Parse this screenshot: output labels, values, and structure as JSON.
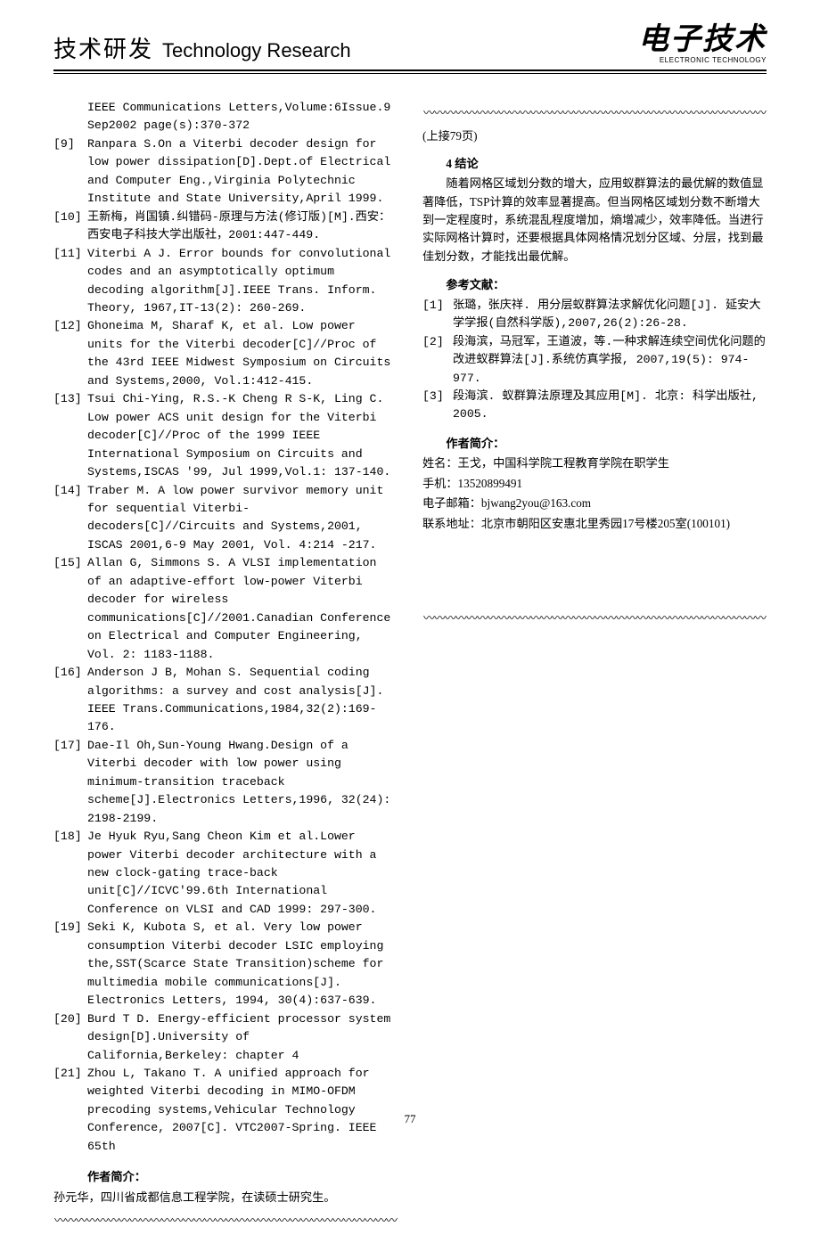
{
  "header": {
    "cn": "技术研发",
    "en": "Technology Research",
    "masthead_cn": "电子技术",
    "masthead_en": "ELECTRONIC TECHNOLOGY"
  },
  "left_col": {
    "cont8": "IEEE Communications Letters,Volume:6Issue.9 Sep2002 page(s):370-372",
    "refs": [
      {
        "n": "[9]",
        "t": "Ranpara S.On a Viterbi decoder design for low power dissipation[D].Dept.of Electrical and Computer Eng.,Virginia Polytechnic Institute and State University,April 1999."
      },
      {
        "n": "[10]",
        "t": "王新梅，肖国镇.纠错码-原理与方法(修订版)[M].西安：西安电子科技大学出版社，2001:447-449."
      },
      {
        "n": "[11]",
        "t": "Viterbi A J. Error bounds for convolutional codes and an asymptotically optimum decoding algorithm[J].IEEE Trans. Inform. Theory, 1967,IT-13(2): 260-269."
      },
      {
        "n": "[12]",
        "t": "Ghoneima M, Sharaf K, et al. Low power units for the Viterbi decoder[C]//Proc of the 43rd IEEE Midwest Symposium on Circuits and Systems,2000, Vol.1:412-415."
      },
      {
        "n": "[13]",
        "t": "Tsui Chi-Ying, R.S.-K Cheng R S-K, Ling C. Low power ACS unit design for the Viterbi decoder[C]//Proc of the 1999 IEEE International Symposium on Circuits and Systems,ISCAS '99, Jul 1999,Vol.1: 137-140."
      },
      {
        "n": "[14]",
        "t": "Traber M. A low power survivor memory unit for sequential Viterbi-decoders[C]//Circuits and Systems,2001, ISCAS 2001,6-9 May 2001, Vol. 4:214 -217."
      },
      {
        "n": "[15]",
        "t": "Allan G, Simmons S. A VLSI implementation of an adaptive-effort low-power Viterbi decoder for wireless communications[C]//2001.Canadian Conference on Electrical and Computer Engineering, Vol. 2: 1183-1188."
      },
      {
        "n": "[16]",
        "t": "Anderson J B, Mohan S. Sequential coding algorithms: a survey and cost analysis[J]. IEEE Trans.Communications,1984,32(2):169-176."
      },
      {
        "n": "[17]",
        "t": "Dae-Il Oh,Sun-Young Hwang.Design of a Viterbi decoder with low power using  minimum-transition traceback scheme[J].Electronics Letters,1996, 32(24): 2198-2199."
      },
      {
        "n": "[18]",
        "t": "Je Hyuk Ryu,Sang Cheon Kim et al.Lower power Viterbi decoder architecture with a new clock-gating trace-back unit[C]//ICVC'99.6th International Conference on VLSI and CAD 1999: 297-300."
      },
      {
        "n": "[19]",
        "t": "Seki K, Kubota S, et al. Very low power consumption Viterbi decoder LSIC employing the,SST(Scarce State Transition)scheme for multimedia mobile communications[J]. Electronics Letters, 1994, 30(4):637-639."
      },
      {
        "n": "[20]",
        "t": "Burd T D. Energy-efficient processor system design[D].University of California,Berkeley: chapter 4"
      },
      {
        "n": "[21]",
        "t": "Zhou L, Takano T. A unified approach for weighted Viterbi decoding in MIMO-OFDM precoding systems,Vehicular Technology Conference, 2007[C]. VTC2007-Spring. IEEE 65th"
      }
    ],
    "author_head": "作者简介：",
    "author_line": "孙元华，四川省成都信息工程学院，在读硕士研究生。"
  },
  "right_col": {
    "cont_from": "(上接79页)",
    "sec4_head": "4 结论",
    "sec4_body": "随着网格区域划分数的增大，应用蚁群算法的最优解的数值显著降低，TSP计算的效率显著提高。但当网格区域划分数不断增大到一定程度时，系统混乱程度增加，熵增减少，效率降低。当进行实际网格计算时，还要根据具体网格情况划分区域、分层，找到最佳划分数，才能找出最优解。",
    "refs_head": "参考文献：",
    "refs": [
      {
        "n": "[1]",
        "t": "张璐，张庆祥. 用分层蚁群算法求解优化问题[J]. 延安大学学报(自然科学版),2007,26(2):26-28."
      },
      {
        "n": "[2]",
        "t": "段海滨，马冠军，王道波，等.一种求解连续空间优化问题的改进蚁群算法[J].系统仿真学报, 2007,19(5): 974-977."
      },
      {
        "n": "[3]",
        "t": "段海滨. 蚁群算法原理及其应用[M]. 北京: 科学出版社, 2005."
      }
    ],
    "author_head": "作者简介：",
    "contact": {
      "name": "姓名：王戈，中国科学院工程教育学院在职学生",
      "phone": "手机：13520899491",
      "email": "电子邮箱：bjwang2you@163.com",
      "addr": "联系地址：北京市朝阳区安惠北里秀园17号楼205室(100101)"
    }
  },
  "squiggle": "〰〰〰〰〰〰〰〰〰〰〰〰〰〰〰〰〰〰〰〰〰〰〰〰〰〰〰〰〰〰〰〰",
  "page_number": "77"
}
